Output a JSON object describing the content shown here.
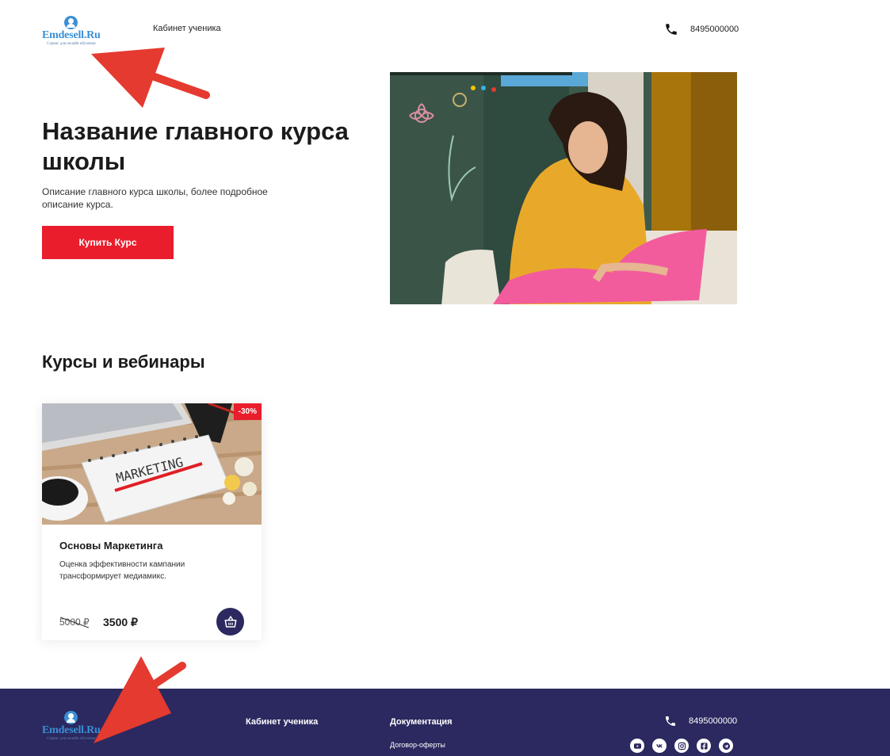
{
  "header": {
    "logo_name": "Emdesell.Ru",
    "logo_tagline": "Сервис для онлайн обучения",
    "nav_cabinet": "Кабинет ученика",
    "phone": "8495000000"
  },
  "hero": {
    "title": "Название главного курса школы",
    "description": "Описание главного курса школы, более подробное описание курса.",
    "button_label": "Купить Курс"
  },
  "courses": {
    "section_title": "Курсы и вебинары",
    "items": [
      {
        "title": "Основы Маркетинга",
        "description": "Оценка эффективности кампании трансформирует медиамикс.",
        "discount": "-30%",
        "old_price": "5000 ₽",
        "new_price": "3500 ₽",
        "image_text": "MARKETING"
      }
    ]
  },
  "footer": {
    "logo_name": "Emdesell.Ru",
    "logo_tagline": "Сервис для онлайн обучения",
    "cabinet": "Кабинет ученика",
    "docs_title": "Документация",
    "docs_link": "Договор-оферты",
    "phone": "8495000000",
    "socials": [
      "youtube-icon",
      "vk-icon",
      "instagram-icon",
      "facebook-icon",
      "telegram-icon"
    ]
  },
  "colors": {
    "accent": "#ea1d2c",
    "footer_bg": "#2b295f",
    "logo_blue": "#3a8fd6",
    "annotation_arrow": "#e53a2f"
  }
}
